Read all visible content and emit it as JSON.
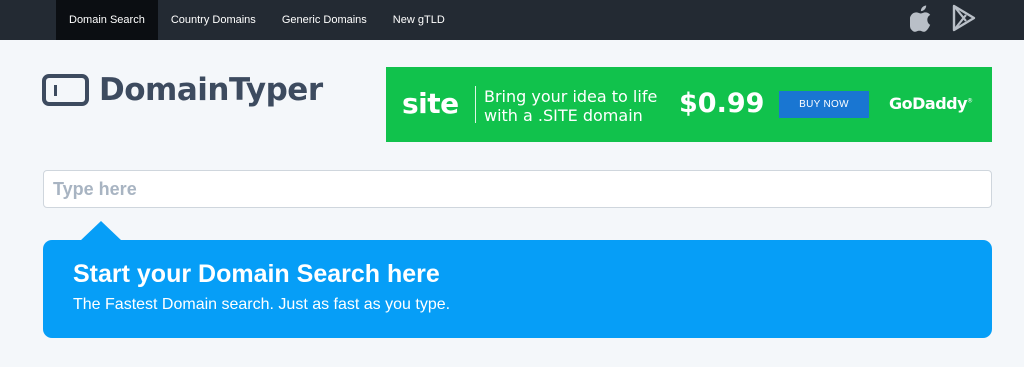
{
  "nav": {
    "items": [
      {
        "label": "Domain Search",
        "active": true
      },
      {
        "label": "Country Domains",
        "active": false
      },
      {
        "label": "Generic Domains",
        "active": false
      },
      {
        "label": "New gTLD",
        "active": false
      }
    ],
    "store_icons": [
      "apple-icon",
      "google-play-icon"
    ]
  },
  "logo": {
    "text": "DomainTyper"
  },
  "ad": {
    "site_word": "site",
    "tagline_line1": "Bring your idea to life",
    "tagline_line2": "with a .SITE domain",
    "price": "$0.99",
    "button_label": "BUY NOW",
    "brand": "GoDaddy",
    "brand_mark": "®"
  },
  "search": {
    "placeholder": "Type here",
    "value": ""
  },
  "panel": {
    "title": "Start your Domain Search here",
    "subtitle": "The Fastest Domain search. Just as fast as you type."
  },
  "colors": {
    "topbar": "#232a33",
    "ad_green": "#11c24c",
    "ad_button": "#1976d2",
    "panel_blue": "#069ef7",
    "logo": "#3d4b5f"
  }
}
